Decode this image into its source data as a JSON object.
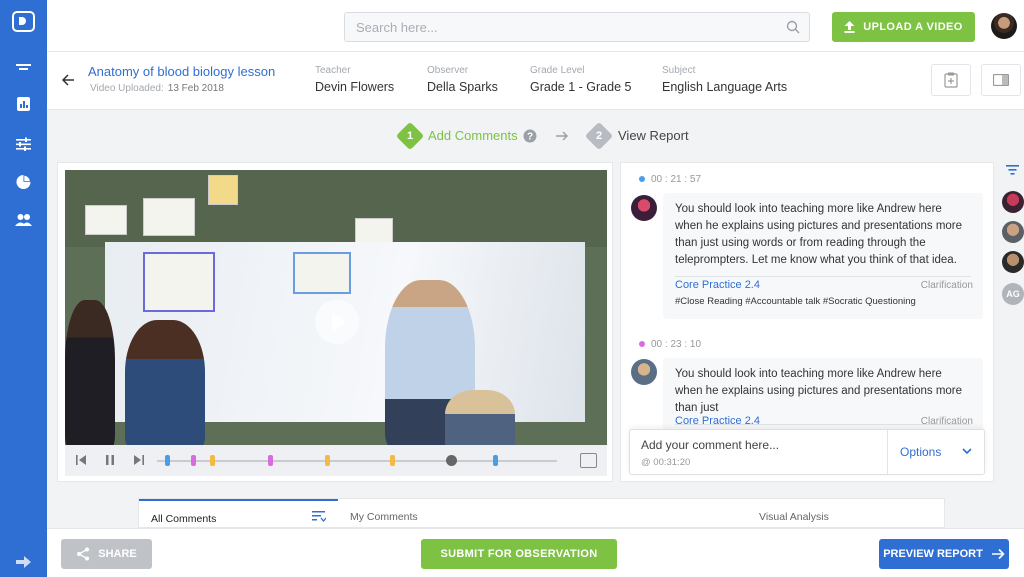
{
  "search": {
    "placeholder": "Search here..."
  },
  "topbar": {
    "upload_label": "UPLOAD A VIDEO"
  },
  "lesson": {
    "title": "Anatomy of blood biology lesson",
    "uploaded_label": "Video Uploaded:",
    "uploaded_date": "13 Feb 2018",
    "fields": [
      {
        "label": "Teacher",
        "value": "Devin Flowers"
      },
      {
        "label": "Observer",
        "value": "Della Sparks"
      },
      {
        "label": "Grade Level",
        "value": "Grade 1 - Grade 5"
      },
      {
        "label": "Subject",
        "value": "English Language Arts"
      }
    ]
  },
  "steps": [
    {
      "number": "1",
      "label": "Add Comments",
      "color": "#7dc243"
    },
    {
      "number": "2",
      "label": "View Report",
      "color": "#b8bcc2"
    }
  ],
  "video": {
    "marker_colors": [
      "#4a9de8",
      "#d66ce0",
      "#f4b942",
      "#d66ce0",
      "#f4b942",
      "#f4b942",
      "#4a9de8"
    ]
  },
  "comments": [
    {
      "timestamp": "00 : 21 : 57",
      "dot_color": "#4a9de8",
      "text": "You should look into teaching more like Andrew here when he explains using pictures and presentations more than just using words or from reading through the teleprompters. Let me know what you think of that idea.",
      "practice": "Core Practice 2.4",
      "category": "Clarification",
      "tags": "#Close Reading   #Accountable talk   #Socratic Questioning"
    },
    {
      "timestamp": "00 : 23 : 10",
      "dot_color": "#d66ce0",
      "text": "You should look into teaching more like Andrew here when he explains using pictures and presentations more than just",
      "practice": "Core Practice 2.4",
      "category": "Clarification"
    }
  ],
  "comment_input": {
    "placeholder": "Add your comment here...",
    "timestamp": "@ 00:31:20",
    "options_label": "Options"
  },
  "rail": {
    "initials": "AG"
  },
  "tabs": [
    "All Comments",
    "My Comments",
    "Visual Analysis"
  ],
  "bottombar": {
    "share_label": "SHARE",
    "submit_label": "SUBMIT FOR OBSERVATION",
    "preview_label": "PREVIEW REPORT"
  },
  "colors": {
    "brand_blue": "#2f6fd3",
    "accent_green": "#7dc243"
  }
}
